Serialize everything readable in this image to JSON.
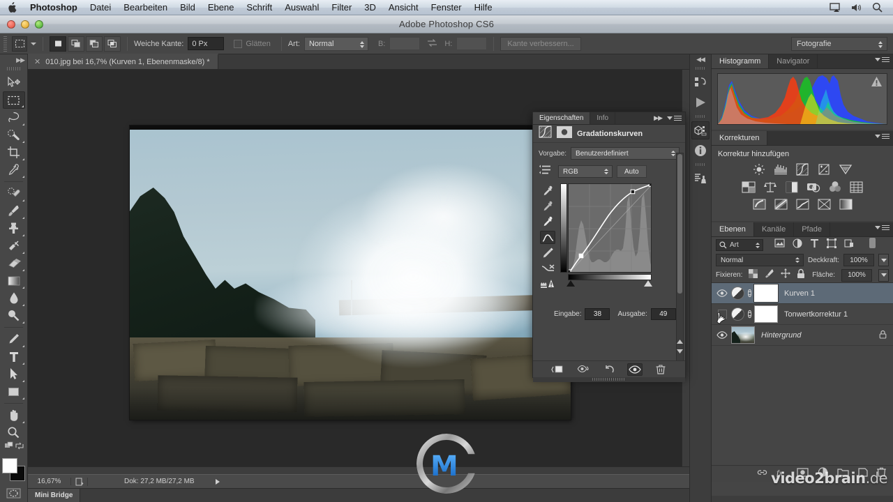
{
  "macbar": {
    "apple_icon": "apple-icon",
    "items": [
      {
        "label": "Photoshop",
        "bold": true
      },
      {
        "label": "Datei",
        "bold": false
      },
      {
        "label": "Bearbeiten",
        "bold": false
      },
      {
        "label": "Bild",
        "bold": false
      },
      {
        "label": "Ebene",
        "bold": false
      },
      {
        "label": "Schrift",
        "bold": false
      },
      {
        "label": "Auswahl",
        "bold": false
      },
      {
        "label": "Filter",
        "bold": false
      },
      {
        "label": "3D",
        "bold": false
      },
      {
        "label": "Ansicht",
        "bold": false
      },
      {
        "label": "Fenster",
        "bold": false
      },
      {
        "label": "Hilfe",
        "bold": false
      }
    ],
    "status_icons": [
      "airplay-icon",
      "volume-icon",
      "search-icon"
    ]
  },
  "titlebar": {
    "title": "Adobe Photoshop CS6",
    "buttons": [
      "close-button",
      "minimize-button",
      "zoom-button"
    ]
  },
  "options_bar": {
    "tool_preview_icon": "rectangular-marquee-icon",
    "selection_modes": [
      "new-selection",
      "add-to-selection",
      "subtract-from-selection",
      "intersect-selection"
    ],
    "feather_label": "Weiche Kante:",
    "feather_value": "0 Px",
    "antialias_label": "Glätten",
    "style_label": "Art:",
    "style_value": "Normal",
    "width_label": "B:",
    "width_value": "",
    "swap_icon": "swap-dimensions-icon",
    "height_label": "H:",
    "height_value": "",
    "refine_edge_label": "Kante verbessern...",
    "workspace_value": "Fotografie"
  },
  "toolbox": {
    "tools": [
      {
        "name": "move-tool",
        "selected": false,
        "has_submenu": false
      },
      {
        "name": "rectangular-marquee-tool",
        "selected": true,
        "has_submenu": true
      },
      {
        "name": "lasso-tool",
        "selected": false,
        "has_submenu": true
      },
      {
        "name": "quick-selection-tool",
        "selected": false,
        "has_submenu": true
      },
      {
        "name": "crop-tool",
        "selected": false,
        "has_submenu": true
      },
      {
        "name": "eyedropper-tool",
        "selected": false,
        "has_submenu": true
      },
      {
        "name": "spot-healing-brush-tool",
        "selected": false,
        "has_submenu": true
      },
      {
        "name": "brush-tool",
        "selected": false,
        "has_submenu": true
      },
      {
        "name": "clone-stamp-tool",
        "selected": false,
        "has_submenu": true
      },
      {
        "name": "history-brush-tool",
        "selected": false,
        "has_submenu": true
      },
      {
        "name": "eraser-tool",
        "selected": false,
        "has_submenu": true
      },
      {
        "name": "gradient-tool",
        "selected": false,
        "has_submenu": true
      },
      {
        "name": "blur-tool",
        "selected": false,
        "has_submenu": true
      },
      {
        "name": "dodge-tool",
        "selected": false,
        "has_submenu": true
      },
      {
        "name": "pen-tool",
        "selected": false,
        "has_submenu": true
      },
      {
        "name": "type-tool",
        "selected": false,
        "has_submenu": true
      },
      {
        "name": "path-selection-tool",
        "selected": false,
        "has_submenu": true
      },
      {
        "name": "rectangle-tool",
        "selected": false,
        "has_submenu": true
      },
      {
        "name": "hand-tool",
        "selected": false,
        "has_submenu": true
      },
      {
        "name": "zoom-tool",
        "selected": false,
        "has_submenu": false
      }
    ],
    "foreground_color": "#ffffff",
    "background_color": "#0a0a0a",
    "quickmask_icon": "quick-mask-icon"
  },
  "document": {
    "tab_title": "010.jpg bei 16,7% (Kurven 1, Ebenenmaske/8) *",
    "close_icon": "close-icon"
  },
  "statusbar": {
    "zoom": "16,67%",
    "doc_icon": "document-icon",
    "doc_info": "Dok: 27,2 MB/27,2 MB",
    "arrow_icon": "play-arrow-icon"
  },
  "minibridge": {
    "label": "Mini Bridge"
  },
  "icon_dock": {
    "buttons": [
      {
        "name": "history-panel-icon",
        "selected": false
      },
      {
        "name": "actions-panel-icon",
        "selected": false
      },
      {
        "name": "3d-panel-icon",
        "selected": true
      },
      {
        "name": "info-panel-icon",
        "selected": false
      },
      {
        "name": "layer-comps-panel-icon",
        "selected": false
      }
    ]
  },
  "properties_panel": {
    "tabs": [
      {
        "label": "Eigenschaften",
        "active": true
      },
      {
        "label": "Info",
        "active": false
      }
    ],
    "collapse_icon": "double-chevron-right-icon",
    "menu_icon": "panel-menu-icon",
    "adjustment_icon": "curves-icon",
    "mask_icon": "mask-thumbnail-icon",
    "title": "Gradationskurven",
    "preset_label": "Vorgabe:",
    "preset_value": "Benutzerdefiniert",
    "channel_value": "RGB",
    "auto_label": "Auto",
    "curve_tools": [
      {
        "name": "on-image-adjust-icon",
        "selected": false
      },
      {
        "name": "black-point-eyedropper-icon",
        "selected": false
      },
      {
        "name": "gray-point-eyedropper-icon",
        "selected": false
      },
      {
        "name": "white-point-eyedropper-icon",
        "selected": false
      },
      {
        "name": "curve-point-tool-icon",
        "selected": true
      },
      {
        "name": "pencil-draw-curve-icon",
        "selected": false
      },
      {
        "name": "smooth-curve-icon",
        "selected": false
      },
      {
        "name": "curve-display-options-icon",
        "selected": false
      }
    ],
    "input_label": "Eingabe:",
    "input_value": "38",
    "output_label": "Ausgabe:",
    "output_value": "49",
    "footer_buttons": [
      {
        "name": "clip-to-layer-icon",
        "selected": false
      },
      {
        "name": "toggle-previous-state-icon",
        "selected": false
      },
      {
        "name": "reset-adjustment-icon",
        "selected": false
      },
      {
        "name": "toggle-visibility-icon",
        "selected": true
      },
      {
        "name": "delete-adjustment-icon",
        "selected": false
      }
    ]
  },
  "chart_data": {
    "type": "line",
    "title": "Gradationskurven (Curves) RGB",
    "xlabel": "Eingabe",
    "ylabel": "Ausgabe",
    "xlim": [
      0,
      255
    ],
    "ylim": [
      0,
      255
    ],
    "grid": true,
    "grid_divisions": 4,
    "series": [
      {
        "name": "RGB curve",
        "points": [
          {
            "input": 0,
            "output": 0
          },
          {
            "input": 38,
            "output": 49
          },
          {
            "input": 196,
            "output": 216
          },
          {
            "input": 255,
            "output": 255
          }
        ],
        "control_points": [
          {
            "input": 0,
            "output": 0,
            "selected": false
          },
          {
            "input": 38,
            "output": 49,
            "selected": true
          },
          {
            "input": 196,
            "output": 216,
            "selected": false
          },
          {
            "input": 255,
            "output": 255,
            "selected": false
          }
        ]
      },
      {
        "name": "baseline diagonal",
        "points": [
          {
            "input": 0,
            "output": 0
          },
          {
            "input": 255,
            "output": 255
          }
        ]
      }
    ],
    "histogram_overlay": [
      4,
      5,
      6,
      8,
      12,
      20,
      34,
      52,
      68,
      78,
      72,
      58,
      42,
      30,
      22,
      17,
      14,
      12,
      11,
      10,
      10,
      11,
      12,
      12,
      11,
      10,
      9,
      9,
      8,
      8,
      9,
      10,
      12,
      14,
      16,
      18,
      19,
      20,
      21,
      22,
      24,
      26,
      28,
      30,
      31,
      31,
      30,
      28,
      26,
      24,
      22,
      20,
      19,
      18,
      18,
      19,
      21,
      24,
      28,
      33,
      40,
      48,
      56,
      62,
      66,
      68,
      67,
      64,
      60,
      55,
      50,
      46,
      43,
      42,
      44,
      50,
      60,
      74,
      88,
      96,
      90,
      76,
      62,
      50,
      42,
      38,
      36,
      35,
      36,
      40,
      48,
      60,
      76,
      92,
      100,
      96,
      84,
      70,
      56,
      44,
      34,
      26,
      20,
      15,
      11,
      8,
      6,
      5,
      4,
      3,
      3,
      2,
      2,
      2,
      1,
      1,
      1,
      1,
      1,
      1,
      1,
      1
    ]
  },
  "histogram_panel": {
    "tabs": [
      {
        "label": "Histogramm",
        "active": true
      },
      {
        "label": "Navigator",
        "active": false
      }
    ],
    "menu_icon": "panel-menu-icon",
    "warning_icon": "uncached-data-warning-icon",
    "chart_data": {
      "type": "area",
      "title": "Histogramm",
      "channels": [
        "red",
        "green",
        "blue"
      ],
      "bins": 256
    }
  },
  "corrections_panel": {
    "tabs": [
      {
        "label": "Korrekturen",
        "active": true
      }
    ],
    "menu_icon": "panel-menu-icon",
    "heading": "Korrektur hinzufügen",
    "rows": [
      [
        "brightness-contrast-icon",
        "levels-icon",
        "curves-icon",
        "exposure-icon",
        "vibrance-icon"
      ],
      [
        "hue-saturation-icon",
        "color-balance-icon",
        "black-white-icon",
        "photo-filter-icon",
        "channel-mixer-icon",
        "color-lookup-icon"
      ],
      [
        "invert-icon",
        "posterize-icon",
        "threshold-icon",
        "selective-color-icon",
        "gradient-map-icon"
      ]
    ]
  },
  "layers_panel": {
    "tabs": [
      {
        "label": "Ebenen",
        "active": true
      },
      {
        "label": "Kanäle",
        "active": false
      },
      {
        "label": "Pfade",
        "active": false
      }
    ],
    "menu_icon": "panel-menu-icon",
    "filter_label": "Art",
    "filter_icon": "search-icon",
    "filter_type_icons": [
      "pixel-filter-icon",
      "adjustment-filter-icon",
      "type-filter-icon",
      "shape-filter-icon",
      "smart-object-filter-icon"
    ],
    "filter_toggle_icon": "filter-power-toggle-icon",
    "blend_mode": "Normal",
    "opacity_label": "Deckkraft:",
    "opacity_value": "100%",
    "lock_label": "Fixieren:",
    "lock_icons": [
      "lock-transparent-pixels-icon",
      "lock-image-pixels-icon",
      "lock-position-icon",
      "lock-all-icon"
    ],
    "fill_label": "Fläche:",
    "fill_value": "100%",
    "layers": [
      {
        "name": "Kurven 1",
        "visible": true,
        "selected": true,
        "type": "adjustment",
        "mask": true,
        "mask_active": true,
        "linked": true,
        "locked": false,
        "italic": false
      },
      {
        "name": "Tonwertkorrektur 1",
        "visible": false,
        "selected": false,
        "type": "adjustment",
        "mask": true,
        "mask_active": false,
        "linked": true,
        "locked": false,
        "italic": false
      },
      {
        "name": "Hintergrund",
        "visible": true,
        "selected": false,
        "type": "image",
        "mask": false,
        "mask_active": false,
        "linked": false,
        "locked": true,
        "italic": true
      }
    ],
    "footer_buttons": [
      "link-layers-icon",
      "layer-style-fx-icon",
      "add-layer-mask-icon",
      "new-adjustment-layer-icon",
      "new-group-icon",
      "new-layer-icon",
      "delete-layer-icon"
    ]
  },
  "watermark": {
    "brand": "video2brain",
    "suffix": ".de",
    "logo_icon": "video2brain-logo-icon"
  },
  "colors": {
    "panel_bg": "#454545",
    "panel_tab_bg": "#333333",
    "selected_layer": "#5d6a77",
    "toolbar_bg": "#474747",
    "canvas_bg": "#292929",
    "accent_blue": "#1f7fe0"
  }
}
